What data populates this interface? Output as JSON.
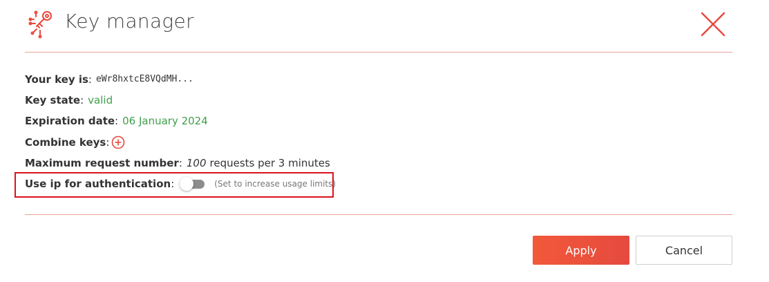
{
  "header": {
    "title": "Key manager",
    "logo_icon": "circuit-key-icon",
    "close_icon": "close-icon",
    "accent_color": "#e8483d"
  },
  "fields": {
    "key": {
      "label": "Your key is",
      "sep": ":",
      "value": "eWr8hxtcE8VQdMH..."
    },
    "state": {
      "label": "Key state",
      "sep": ":",
      "value": "valid",
      "value_color": "#3f9e4a"
    },
    "expiration": {
      "label": "Expiration date",
      "sep": ":",
      "value": "06 January 2024",
      "value_color": "#3f9e4a"
    },
    "combine": {
      "label": "Combine keys",
      "sep": ":",
      "action_icon": "plus-circle-icon"
    },
    "max_requests": {
      "label": "Maximum request number",
      "sep": ":",
      "count": "100",
      "suffix": "requests per 3 minutes"
    },
    "use_ip": {
      "label": "Use ip for authentication",
      "sep": ":",
      "toggle_state": "off",
      "hint": "(Set to increase usage limits)"
    }
  },
  "buttons": {
    "apply": "Apply",
    "cancel": "Cancel"
  }
}
